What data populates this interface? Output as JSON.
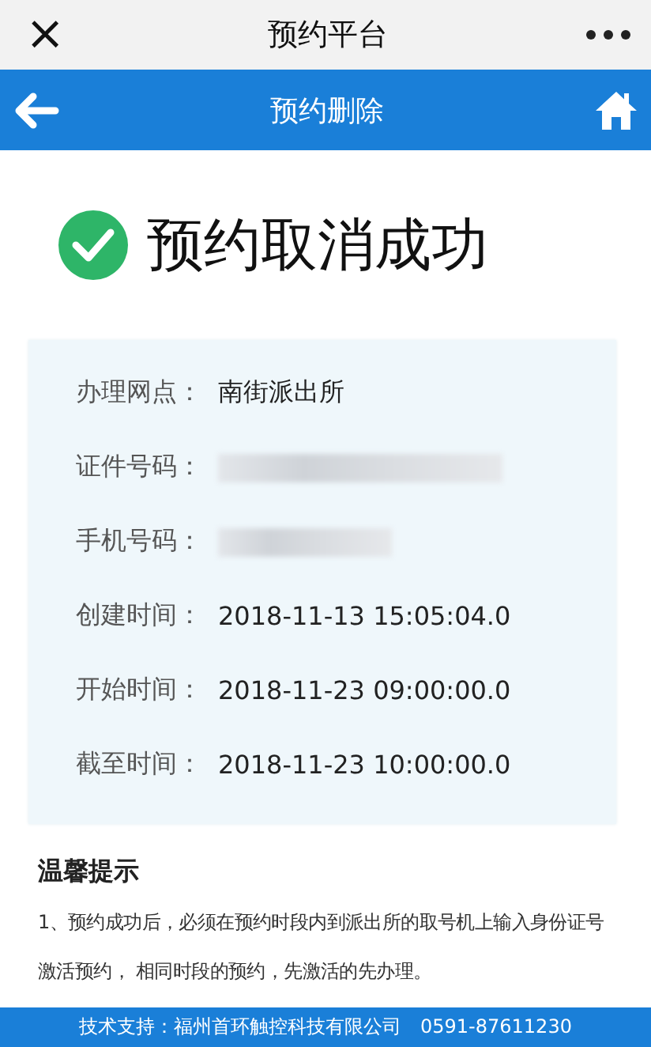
{
  "top_bar": {
    "title": "预约平台",
    "close": "×"
  },
  "nav_bar": {
    "title": "预约删除"
  },
  "result": {
    "message": "预约取消成功"
  },
  "details": [
    {
      "label": "办理网点：",
      "value": "南街派出所",
      "kind": "text"
    },
    {
      "label": "证件号码：",
      "kind": "redacted"
    },
    {
      "label": "手机号码：",
      "kind": "redacted"
    },
    {
      "label": "创建时间：",
      "value": "2018-11-13 15:05:04.0",
      "kind": "text"
    },
    {
      "label": "开始时间：",
      "value": "2018-11-23 09:00:00.0",
      "kind": "text"
    },
    {
      "label": "截至时间：",
      "value": "2018-11-23 10:00:00.0",
      "kind": "text"
    }
  ],
  "notice": {
    "title": "温馨提示",
    "items": [
      "1、预约成功后，必须在预约时段内到派出所的取号机上输入身份证号激活预约， 相同时段的预约，先激活的先办理。"
    ]
  },
  "footer": {
    "text": "技术支持：福州首环触控科技有限公司　0591-87611230"
  }
}
